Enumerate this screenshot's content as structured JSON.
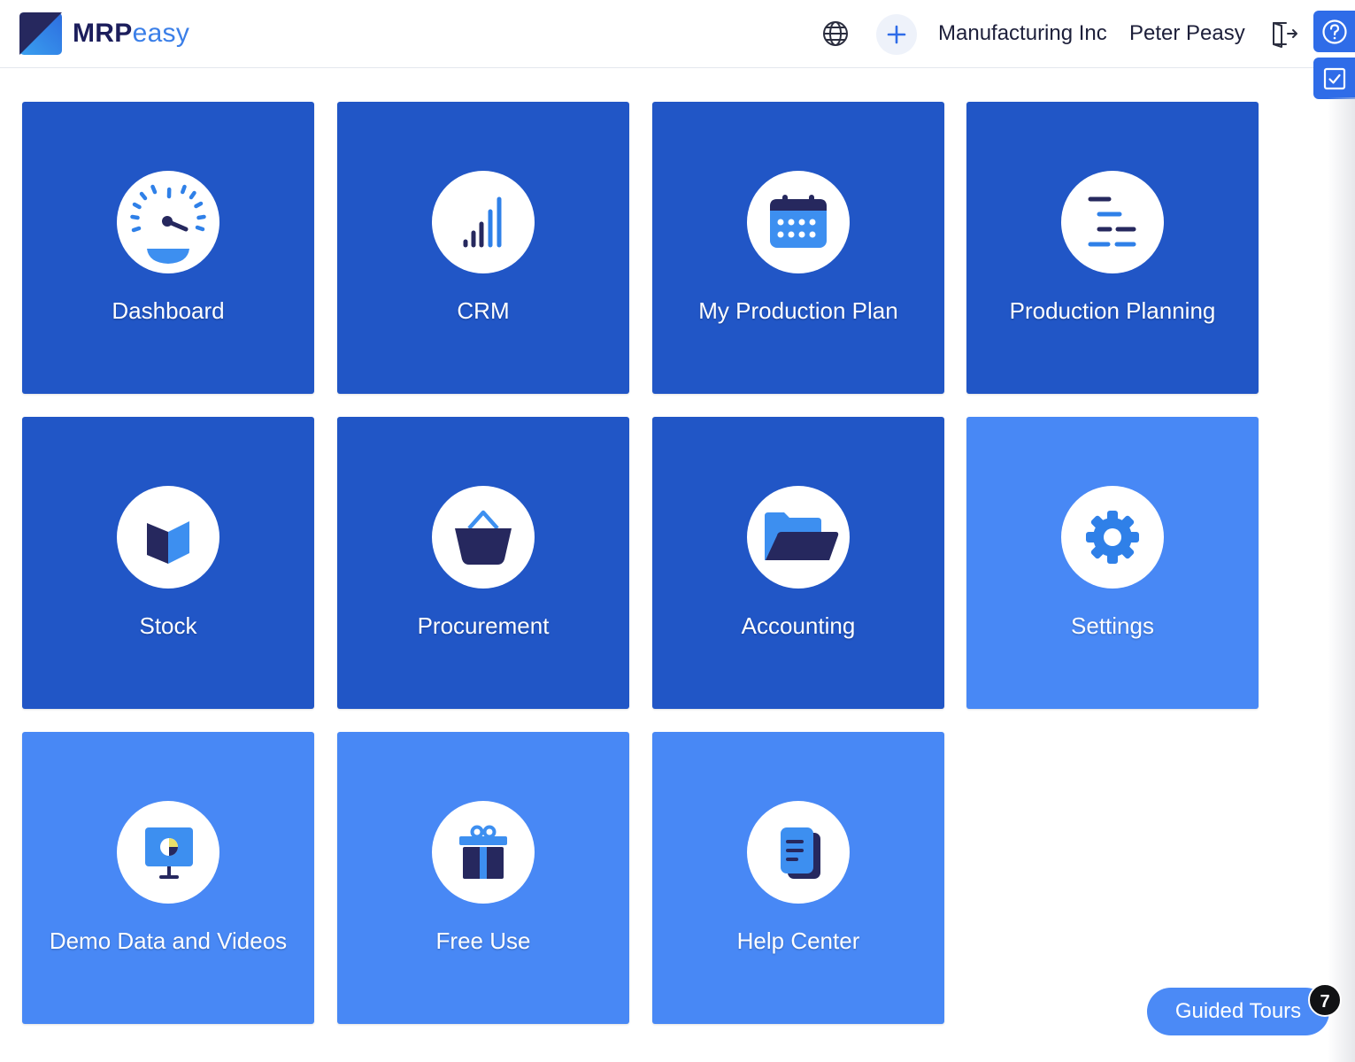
{
  "header": {
    "logo": {
      "strong": "MRP",
      "light": "easy"
    },
    "company": "Manufacturing Inc",
    "user": "Peter Peasy",
    "icons": {
      "language": "globe-icon",
      "create": "plus-icon",
      "logout": "logout-icon",
      "help": "help-circle-icon",
      "tasks": "checkbox-icon"
    }
  },
  "colors": {
    "tile_dark": "#2156c6",
    "tile_light": "#4888f5",
    "brand_navy": "#1c1e5c",
    "brand_blue": "#3b7fe8"
  },
  "tiles": [
    {
      "label": "Dashboard",
      "icon": "speedometer-icon"
    },
    {
      "label": "CRM",
      "icon": "signal-bars-icon"
    },
    {
      "label": "My Production Plan",
      "icon": "calendar-icon"
    },
    {
      "label": "Production Planning",
      "icon": "gantt-lines-icon"
    },
    {
      "label": "Stock",
      "icon": "box-icon"
    },
    {
      "label": "Procurement",
      "icon": "basket-icon"
    },
    {
      "label": "Accounting",
      "icon": "folder-icon"
    },
    {
      "label": "Settings",
      "icon": "gear-icon"
    },
    {
      "label": "Demo Data and Videos",
      "icon": "presentation-icon"
    },
    {
      "label": "Free Use",
      "icon": "gift-icon"
    },
    {
      "label": "Help Center",
      "icon": "document-icon"
    }
  ],
  "guided_tours": {
    "label": "Guided Tours",
    "count": "7"
  }
}
